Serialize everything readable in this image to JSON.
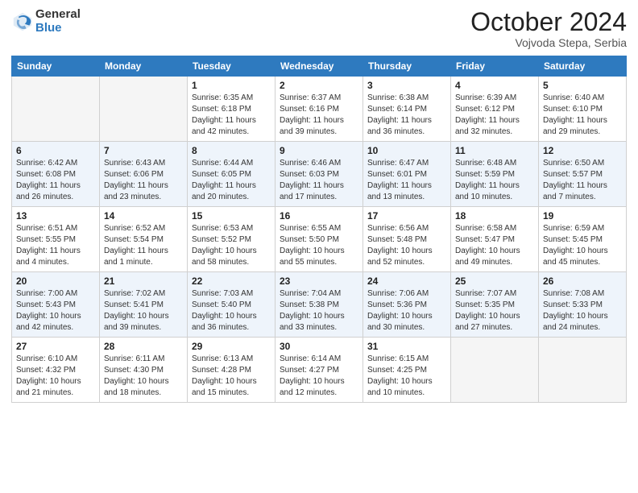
{
  "header": {
    "logo_general": "General",
    "logo_blue": "Blue",
    "main_title": "October 2024",
    "sub_title": "Vojvoda Stepa, Serbia"
  },
  "calendar": {
    "days_of_week": [
      "Sunday",
      "Monday",
      "Tuesday",
      "Wednesday",
      "Thursday",
      "Friday",
      "Saturday"
    ],
    "weeks": [
      {
        "alt": false,
        "days": [
          {
            "number": "",
            "info": ""
          },
          {
            "number": "",
            "info": ""
          },
          {
            "number": "1",
            "info": "Sunrise: 6:35 AM\nSunset: 6:18 PM\nDaylight: 11 hours and 42 minutes."
          },
          {
            "number": "2",
            "info": "Sunrise: 6:37 AM\nSunset: 6:16 PM\nDaylight: 11 hours and 39 minutes."
          },
          {
            "number": "3",
            "info": "Sunrise: 6:38 AM\nSunset: 6:14 PM\nDaylight: 11 hours and 36 minutes."
          },
          {
            "number": "4",
            "info": "Sunrise: 6:39 AM\nSunset: 6:12 PM\nDaylight: 11 hours and 32 minutes."
          },
          {
            "number": "5",
            "info": "Sunrise: 6:40 AM\nSunset: 6:10 PM\nDaylight: 11 hours and 29 minutes."
          }
        ]
      },
      {
        "alt": true,
        "days": [
          {
            "number": "6",
            "info": "Sunrise: 6:42 AM\nSunset: 6:08 PM\nDaylight: 11 hours and 26 minutes."
          },
          {
            "number": "7",
            "info": "Sunrise: 6:43 AM\nSunset: 6:06 PM\nDaylight: 11 hours and 23 minutes."
          },
          {
            "number": "8",
            "info": "Sunrise: 6:44 AM\nSunset: 6:05 PM\nDaylight: 11 hours and 20 minutes."
          },
          {
            "number": "9",
            "info": "Sunrise: 6:46 AM\nSunset: 6:03 PM\nDaylight: 11 hours and 17 minutes."
          },
          {
            "number": "10",
            "info": "Sunrise: 6:47 AM\nSunset: 6:01 PM\nDaylight: 11 hours and 13 minutes."
          },
          {
            "number": "11",
            "info": "Sunrise: 6:48 AM\nSunset: 5:59 PM\nDaylight: 11 hours and 10 minutes."
          },
          {
            "number": "12",
            "info": "Sunrise: 6:50 AM\nSunset: 5:57 PM\nDaylight: 11 hours and 7 minutes."
          }
        ]
      },
      {
        "alt": false,
        "days": [
          {
            "number": "13",
            "info": "Sunrise: 6:51 AM\nSunset: 5:55 PM\nDaylight: 11 hours and 4 minutes."
          },
          {
            "number": "14",
            "info": "Sunrise: 6:52 AM\nSunset: 5:54 PM\nDaylight: 11 hours and 1 minute."
          },
          {
            "number": "15",
            "info": "Sunrise: 6:53 AM\nSunset: 5:52 PM\nDaylight: 10 hours and 58 minutes."
          },
          {
            "number": "16",
            "info": "Sunrise: 6:55 AM\nSunset: 5:50 PM\nDaylight: 10 hours and 55 minutes."
          },
          {
            "number": "17",
            "info": "Sunrise: 6:56 AM\nSunset: 5:48 PM\nDaylight: 10 hours and 52 minutes."
          },
          {
            "number": "18",
            "info": "Sunrise: 6:58 AM\nSunset: 5:47 PM\nDaylight: 10 hours and 49 minutes."
          },
          {
            "number": "19",
            "info": "Sunrise: 6:59 AM\nSunset: 5:45 PM\nDaylight: 10 hours and 45 minutes."
          }
        ]
      },
      {
        "alt": true,
        "days": [
          {
            "number": "20",
            "info": "Sunrise: 7:00 AM\nSunset: 5:43 PM\nDaylight: 10 hours and 42 minutes."
          },
          {
            "number": "21",
            "info": "Sunrise: 7:02 AM\nSunset: 5:41 PM\nDaylight: 10 hours and 39 minutes."
          },
          {
            "number": "22",
            "info": "Sunrise: 7:03 AM\nSunset: 5:40 PM\nDaylight: 10 hours and 36 minutes."
          },
          {
            "number": "23",
            "info": "Sunrise: 7:04 AM\nSunset: 5:38 PM\nDaylight: 10 hours and 33 minutes."
          },
          {
            "number": "24",
            "info": "Sunrise: 7:06 AM\nSunset: 5:36 PM\nDaylight: 10 hours and 30 minutes."
          },
          {
            "number": "25",
            "info": "Sunrise: 7:07 AM\nSunset: 5:35 PM\nDaylight: 10 hours and 27 minutes."
          },
          {
            "number": "26",
            "info": "Sunrise: 7:08 AM\nSunset: 5:33 PM\nDaylight: 10 hours and 24 minutes."
          }
        ]
      },
      {
        "alt": false,
        "days": [
          {
            "number": "27",
            "info": "Sunrise: 6:10 AM\nSunset: 4:32 PM\nDaylight: 10 hours and 21 minutes."
          },
          {
            "number": "28",
            "info": "Sunrise: 6:11 AM\nSunset: 4:30 PM\nDaylight: 10 hours and 18 minutes."
          },
          {
            "number": "29",
            "info": "Sunrise: 6:13 AM\nSunset: 4:28 PM\nDaylight: 10 hours and 15 minutes."
          },
          {
            "number": "30",
            "info": "Sunrise: 6:14 AM\nSunset: 4:27 PM\nDaylight: 10 hours and 12 minutes."
          },
          {
            "number": "31",
            "info": "Sunrise: 6:15 AM\nSunset: 4:25 PM\nDaylight: 10 hours and 10 minutes."
          },
          {
            "number": "",
            "info": ""
          },
          {
            "number": "",
            "info": ""
          }
        ]
      }
    ]
  }
}
